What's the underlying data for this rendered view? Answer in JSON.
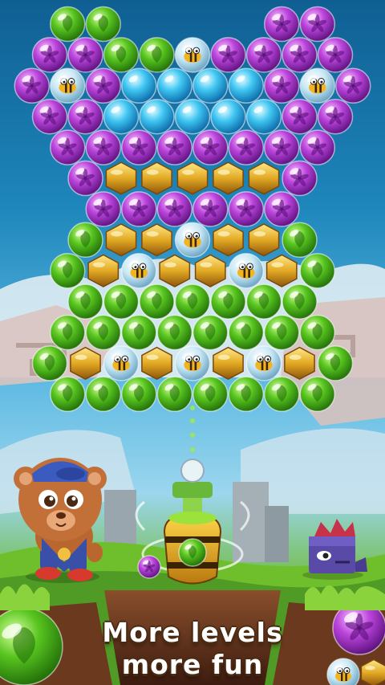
{
  "colors": {
    "green": [
      "#b8f56a",
      "#4fbf1c",
      "#2a7e0d"
    ],
    "purple": [
      "#f3a0f8",
      "#b840d8",
      "#6c1a8e"
    ],
    "blue": [
      "#c8f6ff",
      "#38c2f0",
      "#0f78b8"
    ],
    "gold": [
      "#ffe27a",
      "#e0a821",
      "#9a6010"
    ],
    "bee": [
      "#e8f7ff",
      "#bfe3f2",
      "#6aa7c6"
    ]
  },
  "grid": [
    [
      "",
      "G",
      "G",
      "",
      "",
      "",
      "",
      "P",
      "P",
      ""
    ],
    [
      "P",
      "P",
      "G",
      "G",
      "B",
      "P",
      "P",
      "P",
      "P"
    ],
    [
      "P",
      "Z",
      "P",
      "L",
      "L",
      "L",
      "L",
      "P",
      "Z",
      "P"
    ],
    [
      "P",
      "P",
      "L",
      "L",
      "L",
      "L",
      "L",
      "P",
      "P"
    ],
    [
      "",
      "P",
      "P",
      "P",
      "P",
      "P",
      "P",
      "P",
      "P",
      ""
    ],
    [
      "",
      "P",
      "H",
      "H",
      "H",
      "H",
      "H",
      "P",
      ""
    ],
    [
      "",
      "",
      "P",
      "P",
      "P",
      "P",
      "P",
      "P",
      "",
      ""
    ],
    [
      "",
      "G",
      "H",
      "H",
      "B",
      "H",
      "H",
      "G",
      ""
    ],
    [
      "",
      "G",
      "H",
      "Z",
      "H",
      "H",
      "Z",
      "H",
      "G",
      ""
    ],
    [
      "",
      "G",
      "G",
      "G",
      "G",
      "G",
      "G",
      "G",
      ""
    ],
    [
      "",
      "G",
      "G",
      "G",
      "G",
      "G",
      "G",
      "G",
      "G",
      ""
    ],
    [
      "G",
      "H",
      "Z",
      "H",
      "Z",
      "H",
      "Z",
      "H",
      "G"
    ],
    [
      "",
      "G",
      "G",
      "G",
      "G",
      "G",
      "G",
      "G",
      "G",
      ""
    ]
  ],
  "launcher": {
    "current_bubble": "G",
    "next_bubble": "P"
  },
  "corner_bubbles": [
    "G",
    "P",
    "B",
    "H"
  ],
  "tagline": {
    "line1": "More levels",
    "line2": "more fun"
  }
}
